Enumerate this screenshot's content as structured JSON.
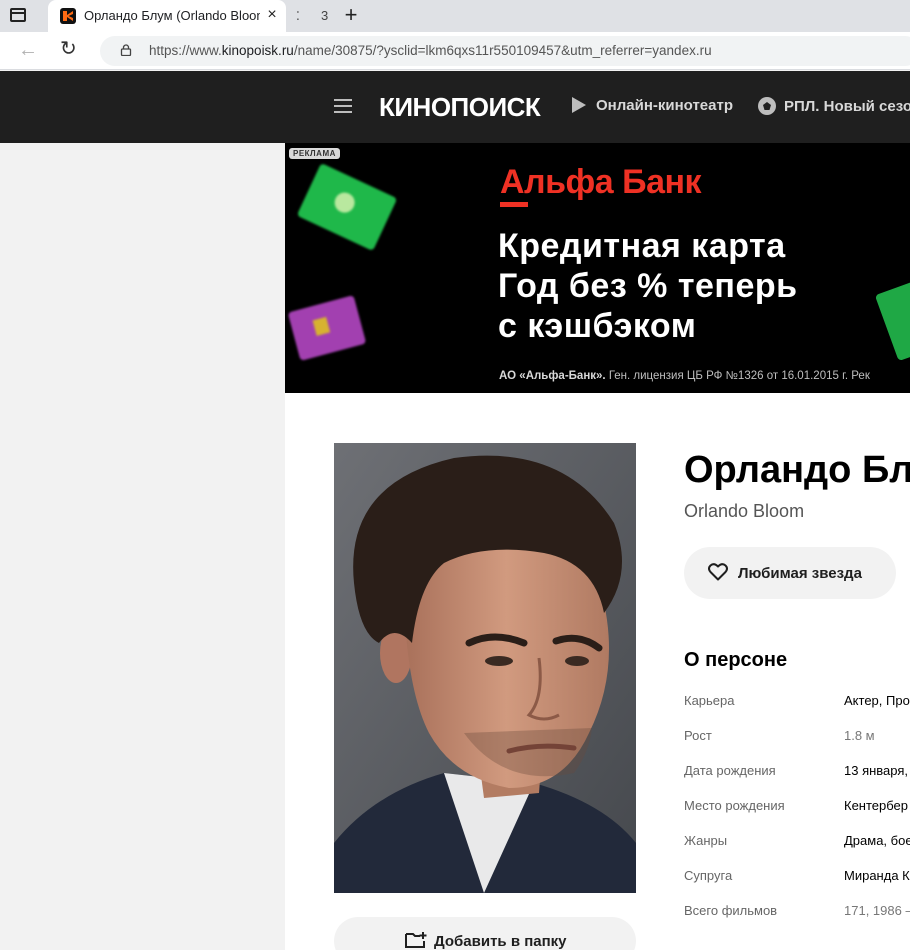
{
  "browser": {
    "tab_title": "Орландо Блум (Orlando Bloom):",
    "tab_count": "3",
    "url_prefix": "https://www.",
    "url_domain": "kinopoisk.ru",
    "url_rest": "/name/30875/?ysclid=lkm6qxs11r550109457&utm_referrer=yandex.ru"
  },
  "header": {
    "logo": "КИНОПОИСК",
    "nav_online": "Онлайн-кинотеатр",
    "nav_rpl": "РПЛ. Новый сезо"
  },
  "ad": {
    "badge": "РЕКЛАМА",
    "brand": "Альфа Банк",
    "line1": "Кредитная карта",
    "line2": "Год без % теперь",
    "line3": "с кэшбэком",
    "legal_bold": "АО «Альфа-Банк».",
    "legal_rest": " Ген. лицензия ЦБ РФ №1326 от 16.01.2015 г. Рек"
  },
  "person": {
    "name_ru": "Орландо Бл",
    "name_en": "Orlando Bloom",
    "favorite_label": "Любимая звезда",
    "folder_label": "Добавить в папку",
    "about_title": "О персоне",
    "facts": [
      {
        "label": "Карьера",
        "value": "Актер, Про"
      },
      {
        "label": "Рост",
        "value": "1.8 м"
      },
      {
        "label": "Дата рождения",
        "value": "13 января,"
      },
      {
        "label": "Место рождения",
        "value": "Кентербер"
      },
      {
        "label": "Жанры",
        "value": "Драма, бое"
      },
      {
        "label": "Супруга",
        "value": "Миранда К"
      },
      {
        "label": "Всего фильмов",
        "value": "171, 1986 —"
      }
    ]
  },
  "colors": {
    "header_bg": "#1f1f1f",
    "alfa_red": "#ef3124",
    "page_bg": "#f2f2f2"
  }
}
